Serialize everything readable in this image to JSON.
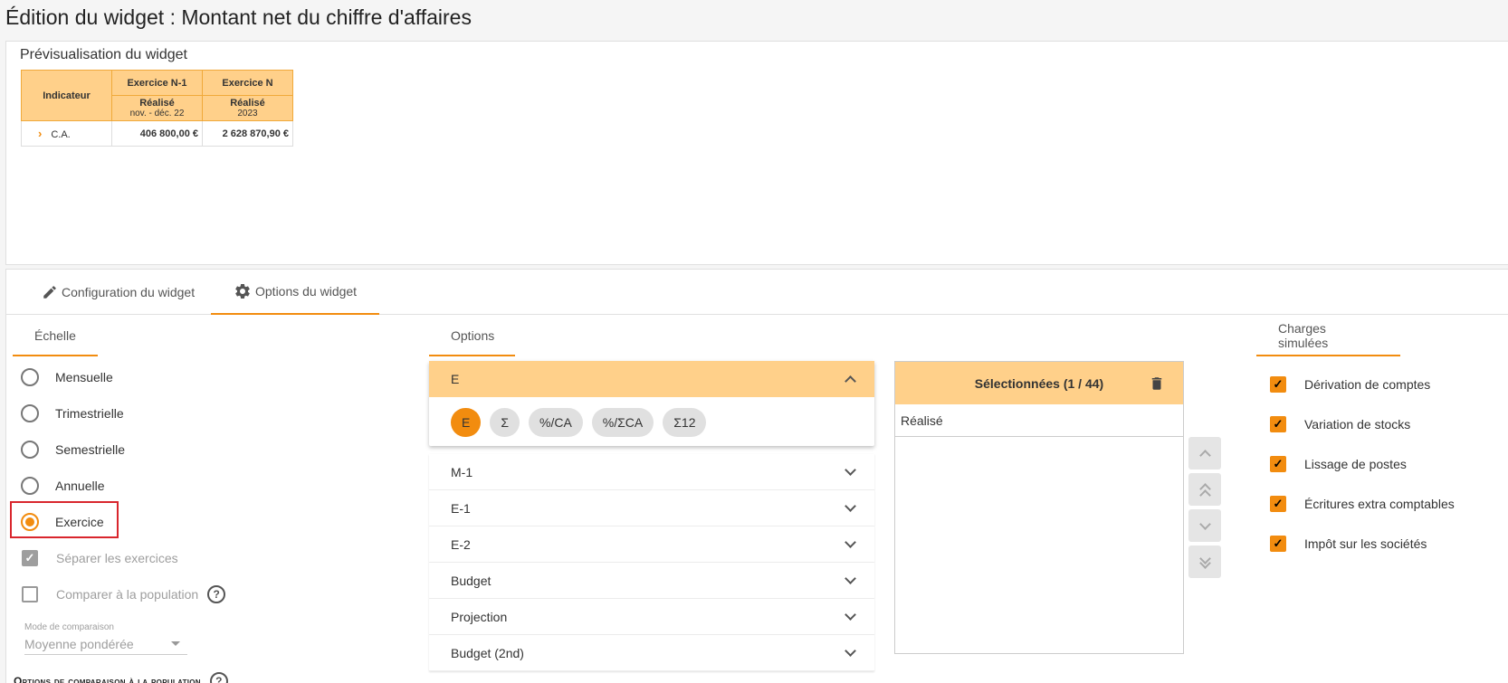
{
  "page_title": "Édition du widget : Montant net du chiffre d'affaires",
  "preview": {
    "title": "Prévisualisation du widget",
    "table": {
      "col_indicateur": "Indicateur",
      "col_n1": "Exercice N-1",
      "col_n": "Exercice N",
      "sub_n1_label": "Réalisé",
      "sub_n1_period": "nov. - déc. 22",
      "sub_n_label": "Réalisé",
      "sub_n_period": "2023",
      "row_label": "C.A.",
      "row_n1": "406 800,00 €",
      "row_n": "2 628 870,90 €"
    }
  },
  "tabs": [
    {
      "label": "Configuration du widget",
      "icon": "pencil-icon"
    },
    {
      "label": "Options du widget",
      "icon": "gear-icon"
    }
  ],
  "sections": {
    "echelle": "Échelle",
    "options": "Options",
    "charges": "Charges simulées"
  },
  "echelle_options": [
    {
      "label": "Mensuelle",
      "selected": false
    },
    {
      "label": "Trimestrielle",
      "selected": false
    },
    {
      "label": "Semestrielle",
      "selected": false
    },
    {
      "label": "Annuelle",
      "selected": false
    },
    {
      "label": "Exercice",
      "selected": true
    }
  ],
  "separer_label": "Séparer les exercices",
  "comparer_label": "Comparer à la population",
  "mode_comparaison": {
    "label": "Mode de comparaison",
    "value": "Moyenne pondérée"
  },
  "options_comparaison_title": "Options de comparaison à la population",
  "accordion_open": {
    "label": "E",
    "chips": [
      {
        "label": "E",
        "selected": true
      },
      {
        "label": "Σ",
        "selected": false
      },
      {
        "label": "%/CA",
        "selected": false
      },
      {
        "label": "%/ΣCA",
        "selected": false
      },
      {
        "label": "Σ12",
        "selected": false
      }
    ]
  },
  "accordion_items": [
    "M-1",
    "E-1",
    "E-2",
    "Budget",
    "Projection",
    "Budget (2nd)"
  ],
  "selected_panel": {
    "title": "Sélectionnées (1 / 44)",
    "items": [
      "Réalisé"
    ]
  },
  "charges_simulees": [
    "Dérivation de comptes",
    "Variation de stocks",
    "Lissage de postes",
    "Écritures extra comptables",
    "Impôt sur les sociétés"
  ],
  "colors": {
    "accent": "#f28c0f",
    "header_bg": "#ffd08a",
    "highlight": "#d9262d"
  }
}
